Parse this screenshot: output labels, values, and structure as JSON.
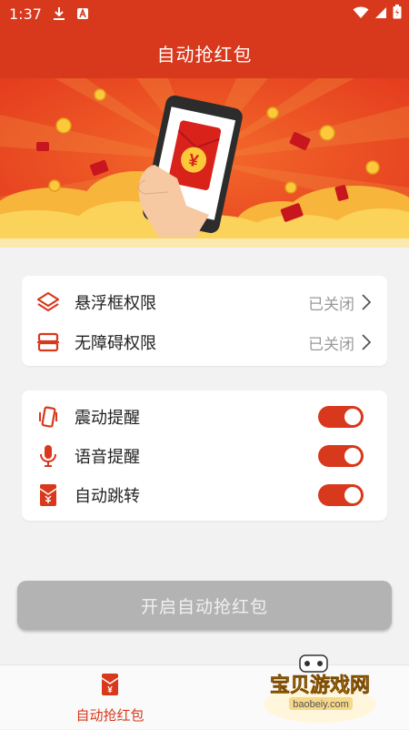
{
  "status_bar": {
    "time": "1:37"
  },
  "app_bar": {
    "title": "自动抢红包"
  },
  "banner": {
    "currency_symbol": "¥"
  },
  "permissions": [
    {
      "label": "悬浮框权限",
      "status": "已关闭",
      "icon": "layers-icon"
    },
    {
      "label": "无障碍权限",
      "status": "已关闭",
      "icon": "accessibility-icon"
    }
  ],
  "settings": [
    {
      "label": "震动提醒",
      "icon": "vibrate-icon",
      "enabled": true
    },
    {
      "label": "语音提醒",
      "icon": "microphone-icon",
      "enabled": true
    },
    {
      "label": "自动跳转",
      "icon": "red-envelope-icon",
      "enabled": true
    }
  ],
  "main_button": {
    "label": "开启自动抢红包"
  },
  "bottom_nav": {
    "label": "自动抢红包",
    "envelope_symbol": "¥"
  },
  "watermark": {
    "title": "宝贝游戏网",
    "url": "baobeiy.com"
  },
  "colors": {
    "accent": "#d8381c",
    "button_disabled": "#b3b3b3",
    "background": "#f2f2f2"
  }
}
